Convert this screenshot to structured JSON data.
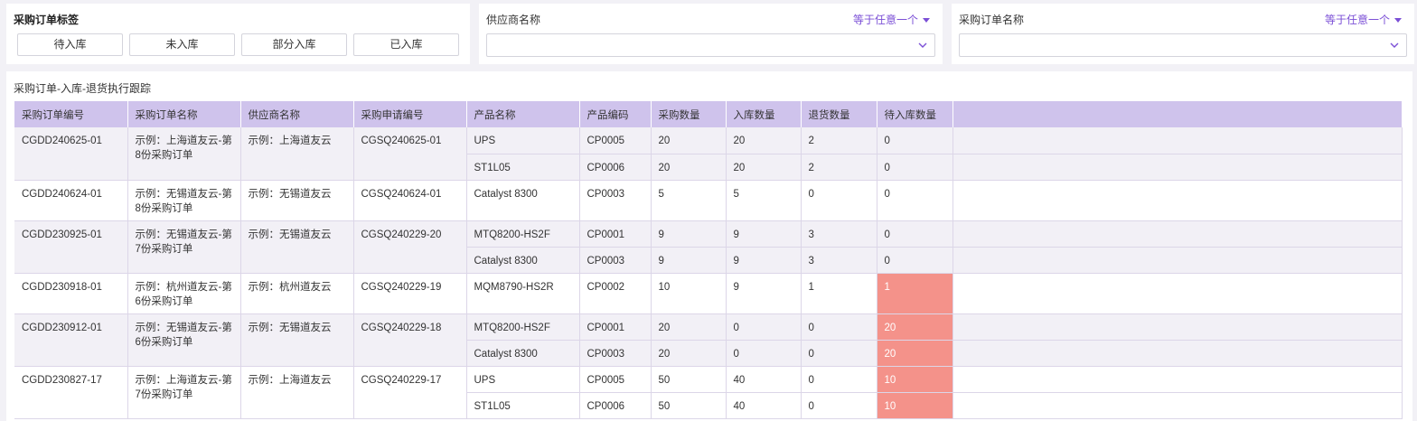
{
  "tags_panel": {
    "title": "采购订单标签",
    "buttons": [
      "待入库",
      "未入库",
      "部分入库",
      "已入库"
    ]
  },
  "supplier_filter": {
    "label": "供应商名称",
    "operator": "等于任意一个",
    "value": ""
  },
  "order_filter": {
    "label": "采购订单名称",
    "operator": "等于任意一个",
    "value": ""
  },
  "table": {
    "title": "采购订单-入库-退货执行跟踪",
    "columns": [
      "采购订单编号",
      "采购订单名称",
      "供应商名称",
      "采购申请编号",
      "产品名称",
      "产品编码",
      "采购数量",
      "入库数量",
      "退货数量",
      "待入库数量"
    ],
    "highlight_color": "#f4928a",
    "groups": [
      {
        "order_no": "CGDD240625-01",
        "order_name": "示例：上海道友云-第8份采购订单",
        "supplier": "示例：上海道友云",
        "request_no": "CGSQ240625-01",
        "items": [
          {
            "product": "UPS",
            "code": "CP0005",
            "qty": "20",
            "in": "20",
            "ret": "2",
            "pending": "0"
          },
          {
            "product": "ST1L05",
            "code": "CP0006",
            "qty": "20",
            "in": "20",
            "ret": "2",
            "pending": "0"
          }
        ]
      },
      {
        "order_no": "CGDD240624-01",
        "order_name": "示例：无锡道友云-第8份采购订单",
        "supplier": "示例：无锡道友云",
        "request_no": "CGSQ240624-01",
        "items": [
          {
            "product": "Catalyst 8300",
            "code": "CP0003",
            "qty": "5",
            "in": "5",
            "ret": "0",
            "pending": "0"
          }
        ]
      },
      {
        "order_no": "CGDD230925-01",
        "order_name": "示例：无锡道友云-第7份采购订单",
        "supplier": "示例：无锡道友云",
        "request_no": "CGSQ240229-20",
        "items": [
          {
            "product": "MTQ8200-HS2F",
            "code": "CP0001",
            "qty": "9",
            "in": "9",
            "ret": "3",
            "pending": "0"
          },
          {
            "product": "Catalyst 8300",
            "code": "CP0003",
            "qty": "9",
            "in": "9",
            "ret": "3",
            "pending": "0"
          }
        ]
      },
      {
        "order_no": "CGDD230918-01",
        "order_name": "示例：杭州道友云-第6份采购订单",
        "supplier": "示例：杭州道友云",
        "request_no": "CGSQ240229-19",
        "items": [
          {
            "product": "MQM8790-HS2R",
            "code": "CP0002",
            "qty": "10",
            "in": "9",
            "ret": "1",
            "pending": "1",
            "highlight": true
          }
        ]
      },
      {
        "order_no": "CGDD230912-01",
        "order_name": "示例：无锡道友云-第6份采购订单",
        "supplier": "示例：无锡道友云",
        "request_no": "CGSQ240229-18",
        "items": [
          {
            "product": "MTQ8200-HS2F",
            "code": "CP0001",
            "qty": "20",
            "in": "0",
            "ret": "0",
            "pending": "20",
            "highlight": true
          },
          {
            "product": "Catalyst 8300",
            "code": "CP0003",
            "qty": "20",
            "in": "0",
            "ret": "0",
            "pending": "20",
            "highlight": true
          }
        ]
      },
      {
        "order_no": "CGDD230827-17",
        "order_name": "示例：上海道友云-第7份采购订单",
        "supplier": "示例：上海道友云",
        "request_no": "CGSQ240229-17",
        "items": [
          {
            "product": "UPS",
            "code": "CP0005",
            "qty": "50",
            "in": "40",
            "ret": "0",
            "pending": "10",
            "highlight": true
          },
          {
            "product": "ST1L05",
            "code": "CP0006",
            "qty": "50",
            "in": "40",
            "ret": "0",
            "pending": "10",
            "highlight": true
          }
        ]
      }
    ]
  }
}
